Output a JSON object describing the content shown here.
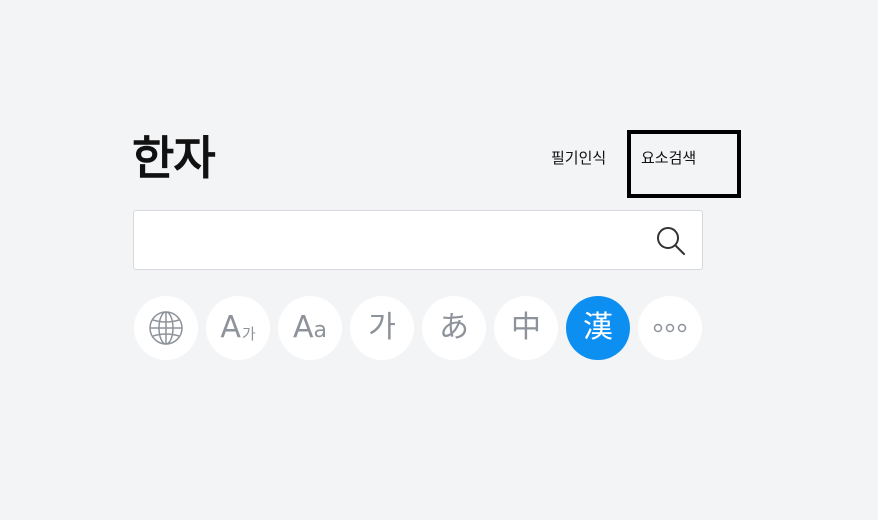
{
  "header": {
    "title": "한자"
  },
  "modes": {
    "handwriting_label": "필기인식",
    "radical_label": "요소검색"
  },
  "search": {
    "placeholder": "",
    "value": ""
  },
  "dictionaries": [
    {
      "glyph": "",
      "icon": "globe-icon",
      "active": false
    },
    {
      "glyph": "A",
      "glyph_small": "가",
      "active": false
    },
    {
      "glyph": "A",
      "glyph_small": "a",
      "active": false
    },
    {
      "glyph": "가",
      "active": false
    },
    {
      "glyph": "あ",
      "active": false
    },
    {
      "glyph": "中",
      "active": false
    },
    {
      "glyph": "漢",
      "active": true
    },
    {
      "glyph": "",
      "icon": "more-icon",
      "active": false
    }
  ],
  "colors": {
    "background": "#f3f4f6",
    "accent": "#0d8ff2",
    "inactive_glyph": "#8e939b"
  }
}
